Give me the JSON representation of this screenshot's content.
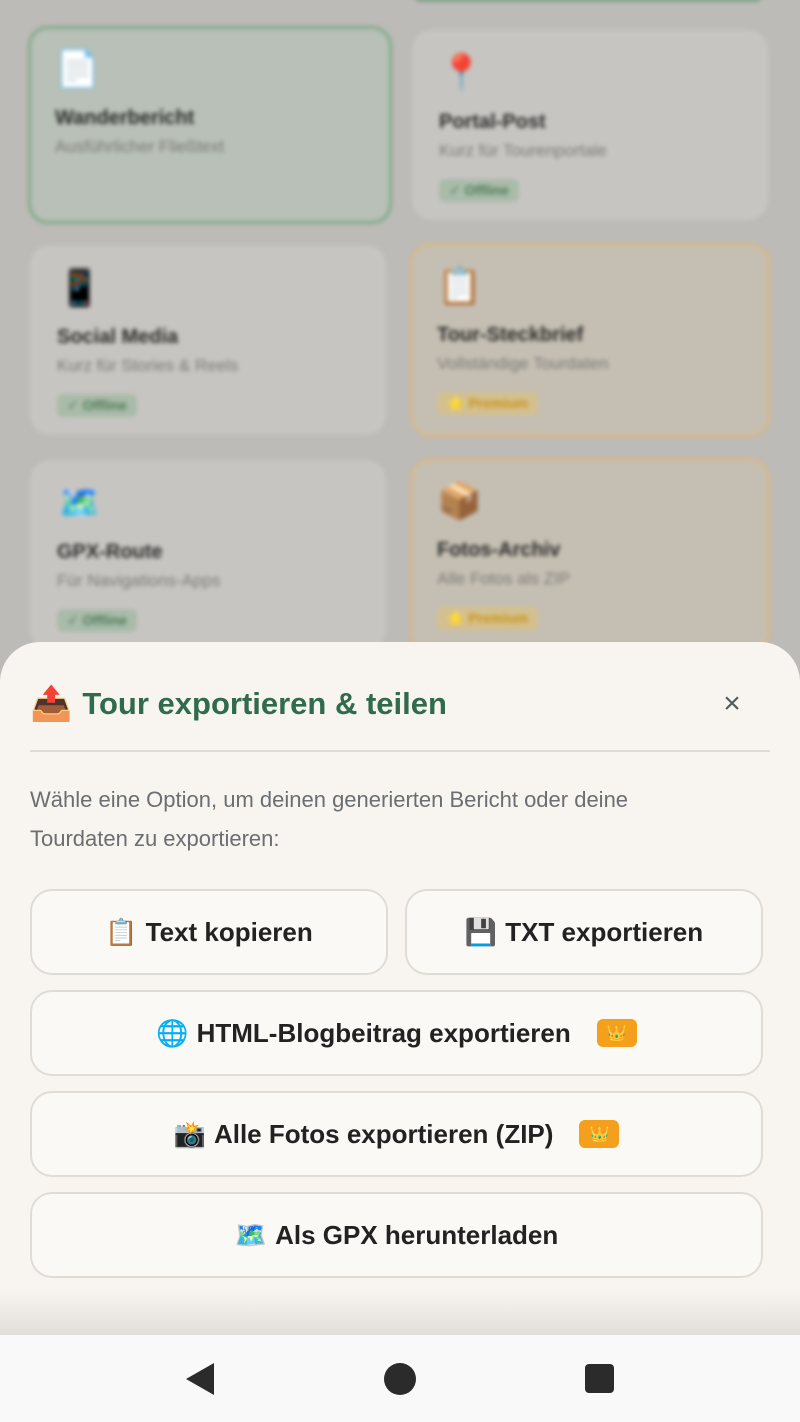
{
  "background": {
    "cards": [
      {
        "icon": "📄",
        "icon_name": "document-icon",
        "title": "Wanderbericht",
        "subtitle": "Ausführlicher Fließtext",
        "badge": ""
      },
      {
        "icon": "📍",
        "icon_name": "pin-icon",
        "title": "Portal-Post",
        "subtitle": "Kurz für Tourenportale",
        "badge": "✓ Offline"
      },
      {
        "icon": "📱",
        "icon_name": "phone-icon",
        "title": "Social Media",
        "subtitle": "Kurz für Stories & Reels",
        "badge": "✓ Offline"
      },
      {
        "icon": "📋",
        "icon_name": "clipboard-icon",
        "title": "Tour-Steckbrief",
        "subtitle": "Vollständige Tourdaten",
        "badge": "⭐ Premium"
      },
      {
        "icon": "🗺️",
        "icon_name": "map-icon",
        "title": "GPX-Route",
        "subtitle": "Für Navigations-Apps",
        "badge": "✓ Offline"
      },
      {
        "icon": "📦",
        "icon_name": "package-icon",
        "title": "Fotos-Archiv",
        "subtitle": "Alle Fotos als ZIP",
        "badge": "⭐ Premium"
      }
    ]
  },
  "sheet": {
    "title_icon": "📤",
    "title": "Tour exportieren & teilen",
    "close": "×",
    "description": "Wähle eine Option, um deinen generierten Bericht oder deine Tourdaten zu exportieren:",
    "buttons": {
      "copy_text": {
        "icon": "📋",
        "label": "Text kopieren"
      },
      "export_txt": {
        "icon": "💾",
        "label": "TXT exportieren"
      },
      "export_html": {
        "icon": "🌐",
        "label": "HTML-Blogbeitrag exportieren",
        "badge": "👑"
      },
      "export_photos": {
        "icon": "📸",
        "label": "Alle Fotos exportieren (ZIP)",
        "badge": "👑"
      },
      "download_gpx": {
        "icon": "🗺️",
        "label": "Als GPX herunterladen"
      }
    }
  },
  "colors": {
    "accent": "#2f6b4c",
    "premium": "#f4a01c",
    "sheet_bg": "#f8f5f0"
  }
}
